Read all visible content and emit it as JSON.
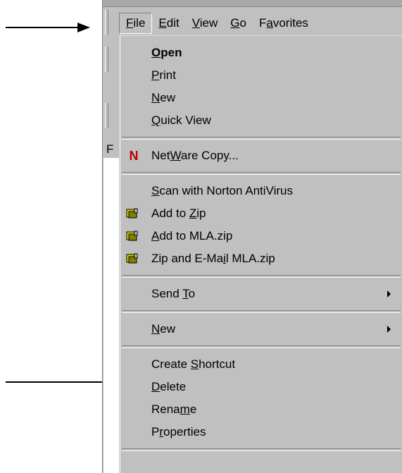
{
  "menubar": {
    "items": [
      {
        "pre": "",
        "u": "F",
        "post": "ile"
      },
      {
        "pre": "",
        "u": "E",
        "post": "dit"
      },
      {
        "pre": "",
        "u": "V",
        "post": "iew"
      },
      {
        "pre": "",
        "u": "G",
        "post": "o"
      },
      {
        "pre": "F",
        "u": "a",
        "post": "vorites"
      }
    ]
  },
  "pane": {
    "header_letter": "F"
  },
  "file_menu": {
    "open": {
      "pre": "",
      "u": "O",
      "post": "pen"
    },
    "print": {
      "pre": "",
      "u": "P",
      "post": "rint"
    },
    "new_item": {
      "pre": "",
      "u": "N",
      "post": "ew"
    },
    "quick_view": {
      "pre": "",
      "u": "Q",
      "post": "uick View"
    },
    "netware_copy": {
      "pre": "Net",
      "u": "W",
      "post": "are Copy..."
    },
    "netware_icon_letter": "N",
    "scan_norton": {
      "pre": "",
      "u": "S",
      "post": "can with Norton AntiVirus"
    },
    "add_to_zip": {
      "pre": "Add to ",
      "u": "Z",
      "post": "ip"
    },
    "add_to_mla": {
      "pre": "",
      "u": "A",
      "post": "dd to MLA.zip"
    },
    "zip_email": {
      "pre": "Zip and E-Ma",
      "u": "i",
      "post": "l MLA.zip"
    },
    "send_to": {
      "pre": "Send ",
      "u": "T",
      "post": "o"
    },
    "new_sub": {
      "pre": "",
      "u": "N",
      "post": "ew"
    },
    "create_shortcut": {
      "pre": "Create ",
      "u": "S",
      "post": "hortcut"
    },
    "delete": {
      "pre": "",
      "u": "D",
      "post": "elete"
    },
    "rename": {
      "pre": "Rena",
      "u": "m",
      "post": "e"
    },
    "properties": {
      "pre": "P",
      "u": "r",
      "post": "operties"
    }
  },
  "icons": {
    "netware": "netware-n-icon",
    "zip": "winzip-vise-icon",
    "submenu": "submenu-arrow-icon",
    "annotation": "annotation-arrow-icon"
  },
  "colors": {
    "menu_bg": "#c0c0c0",
    "netware_red": "#c00000",
    "zip_yellow": "#e8d000"
  }
}
